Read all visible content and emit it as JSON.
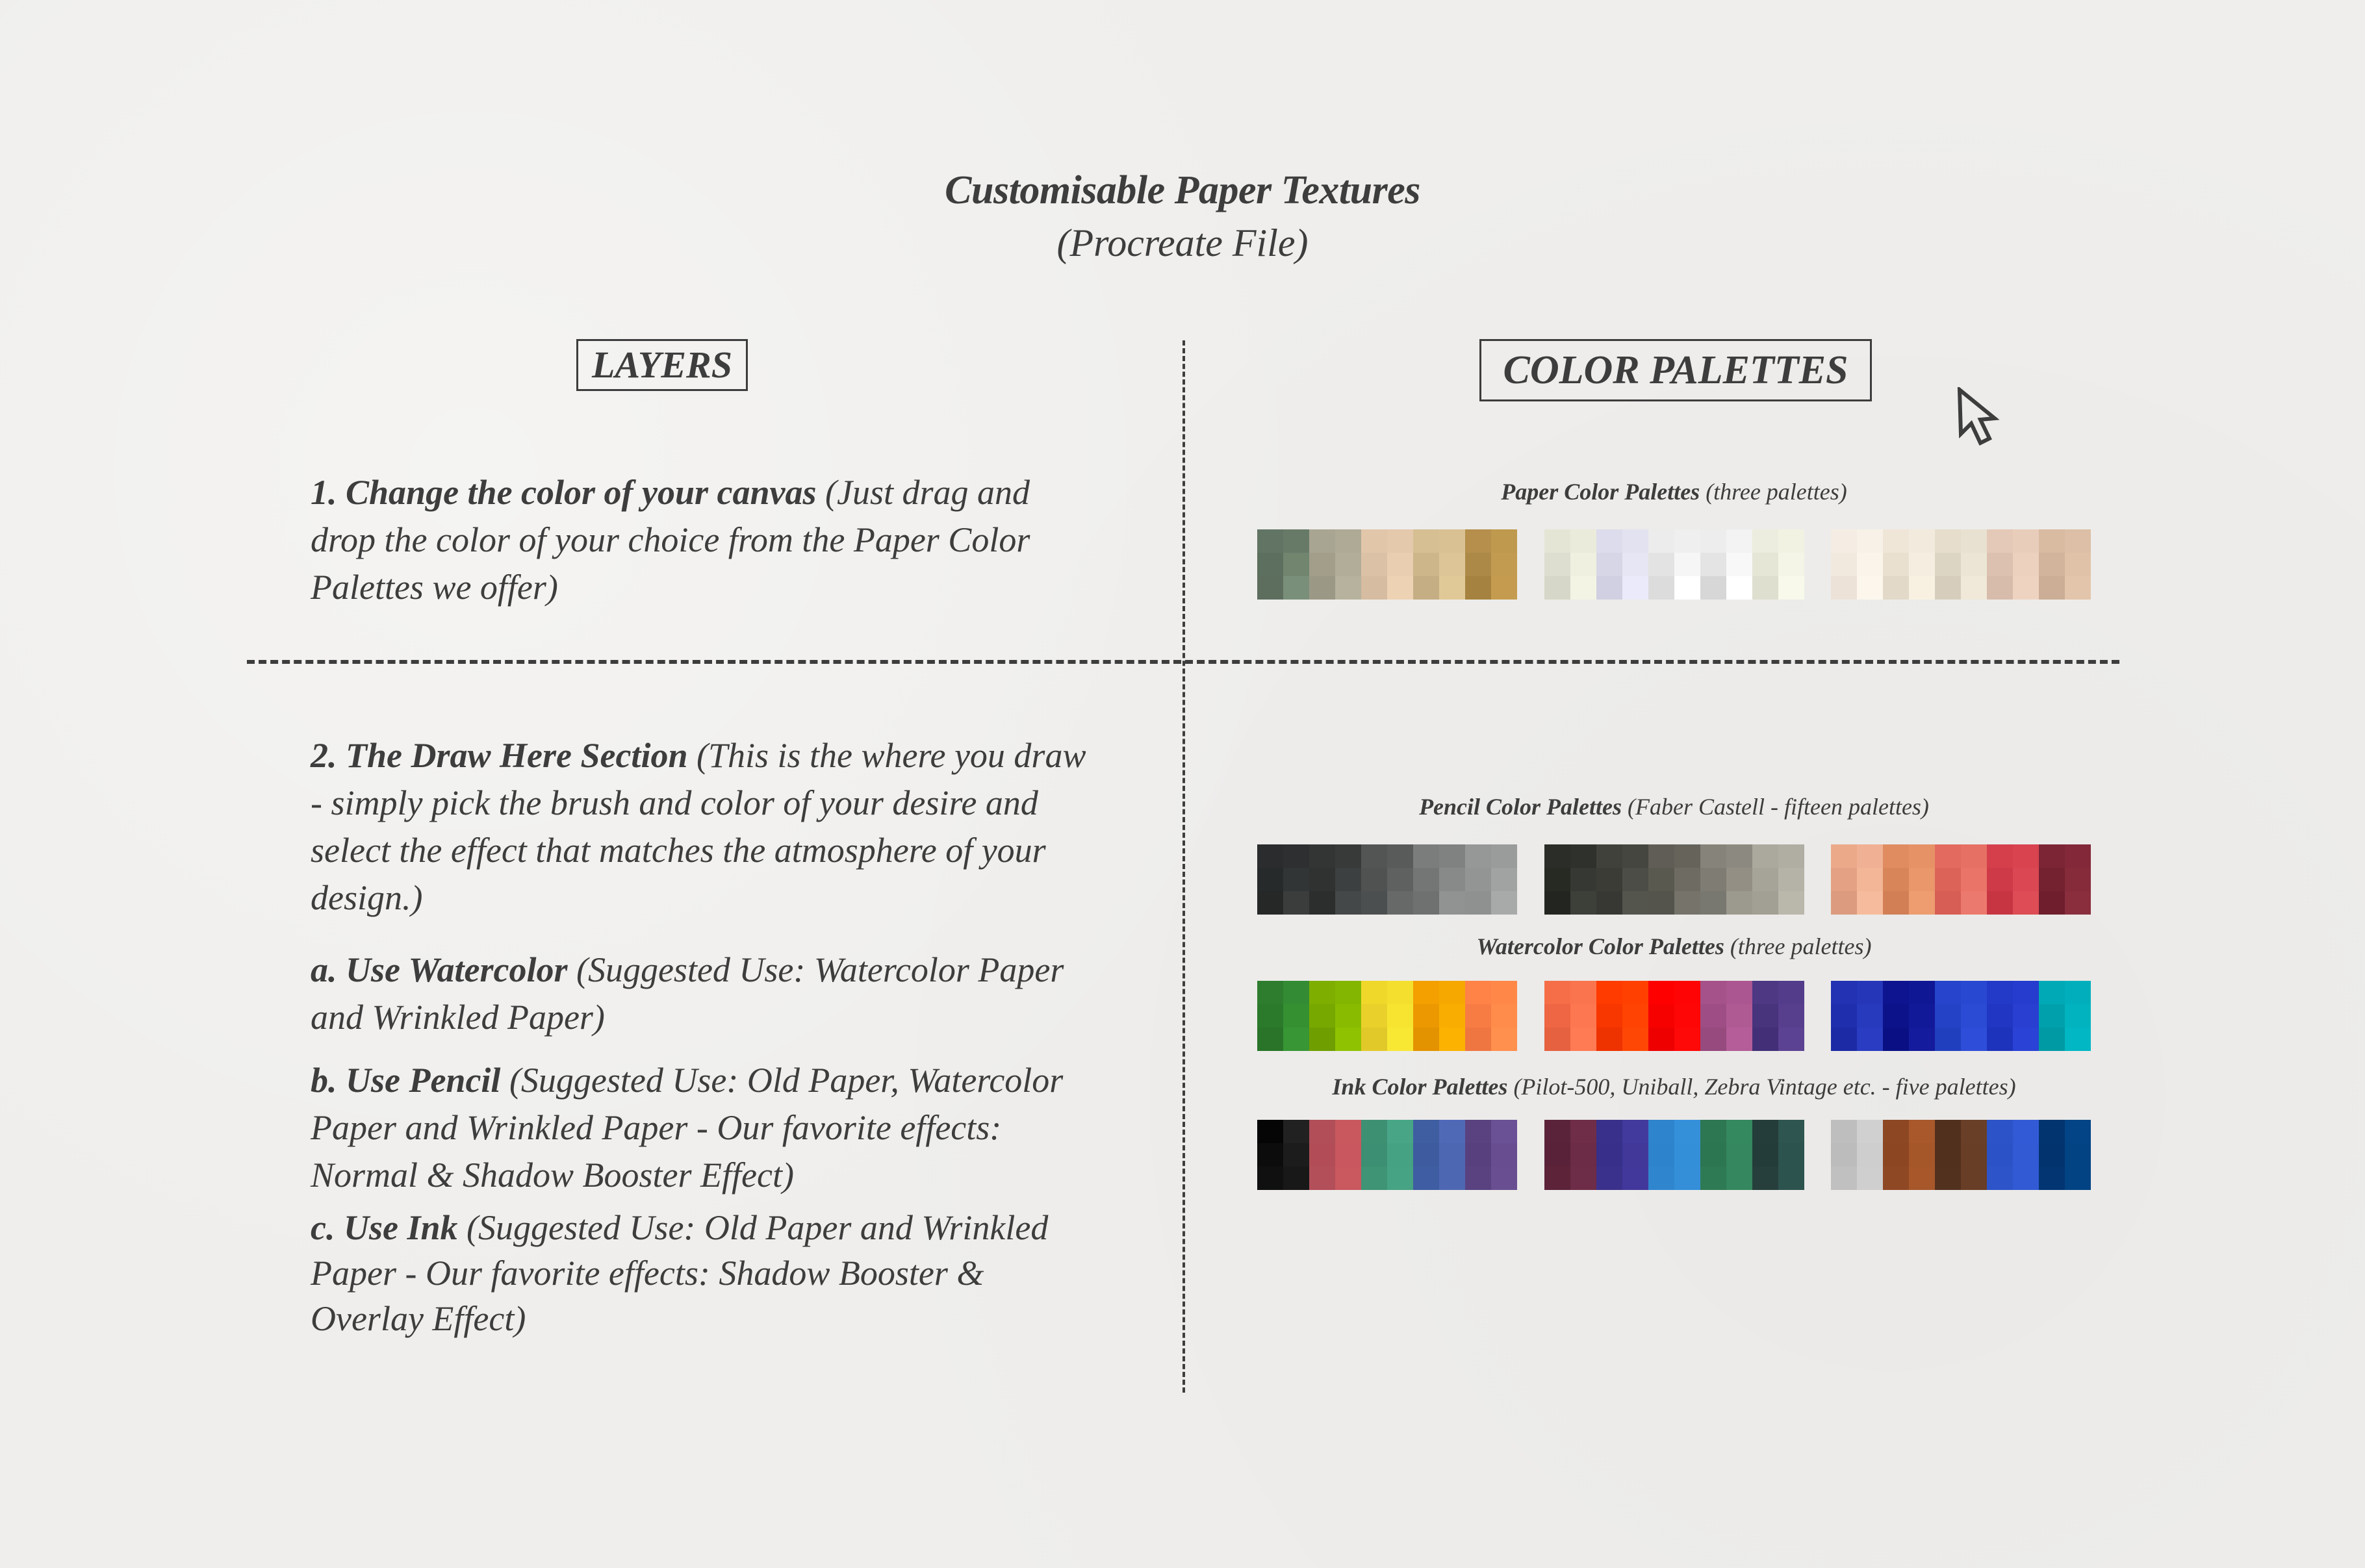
{
  "header": {
    "title": "Customisable Paper Textures",
    "subtitle": "(Procreate File)"
  },
  "layers": {
    "heading": "LAYERS",
    "items": [
      {
        "bold": "1. Change the color of your canvas",
        "text": " (Just drag and drop the color of your choice from the Paper Color Palettes we offer)"
      },
      {
        "bold": "2. The Draw Here Section",
        "text": " (This is the where you draw - simply pick the brush and color of your desire and select the effect that matches the atmosphere of your design.)"
      },
      {
        "bold": "a. Use Watercolor",
        "text": " (Suggested Use: Watercolor Paper and Wrinkled Paper)"
      },
      {
        "bold": "b. Use Pencil",
        "text": " (Suggested Use: Old Paper, Watercolor Paper and Wrinkled Paper - Our favorite effects: Normal & Shadow Booster Effect)"
      },
      {
        "bold": "c. Use Ink",
        "text": " (Suggested Use: Old Paper and Wrinkled Paper - Our favorite effects: Shadow Booster & Overlay Effect)"
      }
    ]
  },
  "color_palettes": {
    "heading": "COLOR PALETTES",
    "cursor_icon": "mouse-pointer-arrow",
    "sections": [
      {
        "name": "Paper Color Palettes",
        "note": " (three palettes)",
        "palettes": [
          [
            "#627565",
            "#5d6f5e",
            "#5d6e5e",
            "#677a68",
            "#71856f",
            "#7a8f79",
            "#a9a593",
            "#a29e89",
            "#9b9986",
            "#aeaa96",
            "#b2ad98",
            "#b7b29d",
            "#e1c6aa",
            "#dbc1a6",
            "#d6bca0",
            "#e4c9ad",
            "#e9ceb2",
            "#edd2b4",
            "#d5bf93",
            "#cdb68a",
            "#c6ae84",
            "#d9c194",
            "#dec598",
            "#e1c897",
            "#b58f4b",
            "#ad8948",
            "#a5823f",
            "#bf994e",
            "#c29b50",
            "#c59c4f"
          ],
          [
            "#e5e5d6",
            "#deded0",
            "#d6d7c8",
            "#ebebdc",
            "#f0f0e0",
            "#f4f4e4",
            "#dcdcec",
            "#d6d6e6",
            "#d0d0e2",
            "#e2e2f0",
            "#e6e6f4",
            "#eaeafa",
            "#ececec",
            "#e3e3e3",
            "#dcdcdc",
            "#efefef",
            "#f6f6f6",
            "#ffffff",
            "#ededed",
            "#e4e4e4",
            "#d7d7d7",
            "#f3f3f3",
            "#f8f8f8",
            "#ffffff",
            "#ecedde",
            "#e5e6d5",
            "#dedfcf",
            "#f1f2e2",
            "#f4f5e6",
            "#f8f9ea"
          ],
          [
            "#f5ede4",
            "#f2e9de",
            "#ece2d8",
            "#f8f1e8",
            "#fbf4ea",
            "#fdf6ec",
            "#efe6d8",
            "#e9e0d0",
            "#e2d9c9",
            "#f2ebdd",
            "#f5eddf",
            "#f8f1e2",
            "#e6ddcc",
            "#ddd5c4",
            "#d6cdbc",
            "#e8e1d1",
            "#ece5d5",
            "#f0e9d9",
            "#e5c9b8",
            "#dcc1b0",
            "#d7bcab",
            "#e8cdbb",
            "#ecd1bf",
            "#efd3c1",
            "#d9bba2",
            "#d1b49b",
            "#cbae95",
            "#dcbfa6",
            "#e0c2a8",
            "#e3c5ab"
          ]
        ]
      },
      {
        "name": "Pencil Color Palettes",
        "note": " (Faber Castell - fifteen palettes)",
        "palettes": [
          [
            "#2a2c2d",
            "#272a2a",
            "#252827",
            "#2d2f30",
            "#323535",
            "#3a3d3c",
            "#333535",
            "#2f3231",
            "#2c2e2e",
            "#383a3a",
            "#3d4040",
            "#454848",
            "#535555",
            "#505252",
            "#4c4f4f",
            "#595b5b",
            "#5f6161",
            "#676969",
            "#7b7d7d",
            "#747676",
            "#6f7171",
            "#808282",
            "#888a8a",
            "#919393",
            "#969898",
            "#939595",
            "#8f9191",
            "#9a9c9c",
            "#a1a3a3",
            "#a8aaaa"
          ],
          [
            "#2b2d28",
            "#272923",
            "#232520",
            "#2f322c",
            "#363833",
            "#3d3f39",
            "#40413b",
            "#3b3c36",
            "#373833",
            "#45463f",
            "#4c4d46",
            "#54554d",
            "#5f5d55",
            "#5a5950",
            "#55544c",
            "#65635a",
            "#6d6b62",
            "#75736a",
            "#86847a",
            "#7f7d73",
            "#797870",
            "#8c8a80",
            "#948f85",
            "#9c9a8f",
            "#aba89e",
            "#a6a398",
            "#a29f95",
            "#b0ada3",
            "#b5b2a7",
            "#bab7ab"
          ],
          [
            "#eba98a",
            "#e4a183",
            "#dc9b7e",
            "#f0b093",
            "#f3b697",
            "#f6bb9c",
            "#e08c60",
            "#d9855a",
            "#d27f56",
            "#e69266",
            "#ea976b",
            "#ed9d6f",
            "#e36a5f",
            "#dc6358",
            "#d65e54",
            "#e67064",
            "#ea7468",
            "#ec796d",
            "#d53f4c",
            "#ce3a47",
            "#c73543",
            "#d8434f",
            "#db4752",
            "#de4c56",
            "#7b2535",
            "#742130",
            "#6e1e2d",
            "#822838",
            "#862b3a",
            "#8a2e3d"
          ]
        ]
      },
      {
        "name": "Watercolor Color Palettes",
        "note": " (three palettes)",
        "palettes": [
          [
            "#2e7d2e",
            "#2b7a2b",
            "#297428",
            "#338b33",
            "#359032",
            "#389635",
            "#7dae00",
            "#77a800",
            "#6f9e00",
            "#83b600",
            "#89bc00",
            "#8fc200",
            "#f0d82a",
            "#ead02a",
            "#e2c92a",
            "#f4df2e",
            "#f6e430",
            "#f8e833",
            "#f3a000",
            "#ec9800",
            "#e39200",
            "#f6a700",
            "#f9ad00",
            "#fbb200",
            "#ff8247",
            "#f77c43",
            "#ef7541",
            "#ff8849",
            "#ff8c4b",
            "#ff904d"
          ],
          [
            "#f56e48",
            "#ee6644",
            "#e66140",
            "#fa744d",
            "#fd7750",
            "#ff7b53",
            "#ff3b00",
            "#f73600",
            "#ee3200",
            "#ff4000",
            "#ff4302",
            "#ff4705",
            "#ff0000",
            "#f70000",
            "#ee0000",
            "#ff0404",
            "#ff0606",
            "#ff0808",
            "#a5528a",
            "#9e4e84",
            "#964a7e",
            "#ab5690",
            "#b05a94",
            "#b45d98",
            "#4e3884",
            "#48337d",
            "#432f77",
            "#533c8a",
            "#573f8e",
            "#5b4292"
          ],
          [
            "#2232b3",
            "#1f2ead",
            "#1c2aa6",
            "#2536b9",
            "#2739bd",
            "#293cc2",
            "#0e148f",
            "#0c1289",
            "#0a1083",
            "#101794",
            "#121998",
            "#141b9c",
            "#2645cc",
            "#2342c6",
            "#203fbf",
            "#2948d1",
            "#2b4bd5",
            "#2e4ed9",
            "#2339c8",
            "#2136c2",
            "#1e33bc",
            "#263cce",
            "#283fd2",
            "#2a42d6",
            "#00a9b6",
            "#00a1ad",
            "#009aa5",
            "#00afbb",
            "#00b3bf",
            "#00b7c3"
          ]
        ]
      },
      {
        "name": "Ink Color Palettes",
        "note": " (Pilot-500, Uniball, Zebra Vintage etc. - five palettes)",
        "palettes": [
          [
            "#050505",
            "#0c0c0c",
            "#101010",
            "#212121",
            "#1c1c1c",
            "#181818",
            "#b14e58",
            "#b24d57",
            "#b34f59",
            "#c8585e",
            "#c85760",
            "#c9585f",
            "#3e9073",
            "#3c8f72",
            "#3e9475",
            "#48a687",
            "#45a283",
            "#46a384",
            "#3e5ea1",
            "#3d5b9e",
            "#3f5da2",
            "#5069b7",
            "#4e67b3",
            "#4e67b3",
            "#5a4180",
            "#58407e",
            "#5a4281",
            "#6a5094",
            "#684e91",
            "#694f92"
          ],
          [
            "#5a2339",
            "#5a2238",
            "#5c2339",
            "#6f2d48",
            "#6c2b46",
            "#6d2c47",
            "#38308a",
            "#372f89",
            "#3a318c",
            "#433a9d",
            "#41389a",
            "#42389b",
            "#2e84cd",
            "#2d83cc",
            "#2f86ce",
            "#3590da",
            "#348fd9",
            "#348ed8",
            "#2d7752",
            "#2c7651",
            "#2e7a54",
            "#35895f",
            "#34875e",
            "#34875e",
            "#243d3a",
            "#243c39",
            "#263f3c",
            "#2e5550",
            "#2d534e",
            "#2d534e"
          ],
          [
            "#bebebe",
            "#bcbcbc",
            "#c0c0c0",
            "#d0d0d0",
            "#cecece",
            "#cfcfcf",
            "#8d4723",
            "#8c4622",
            "#8f4824",
            "#a8582b",
            "#a6572a",
            "#a7572a",
            "#52301e",
            "#51301d",
            "#53311f",
            "#6a3f27",
            "#683e26",
            "#693e26",
            "#2c53c7",
            "#2b52c6",
            "#2d55c9",
            "#335ad6",
            "#325ad5",
            "#325ad5",
            "#023470",
            "#02336f",
            "#033572",
            "#024485",
            "#024383",
            "#024383"
          ]
        ]
      }
    ]
  }
}
